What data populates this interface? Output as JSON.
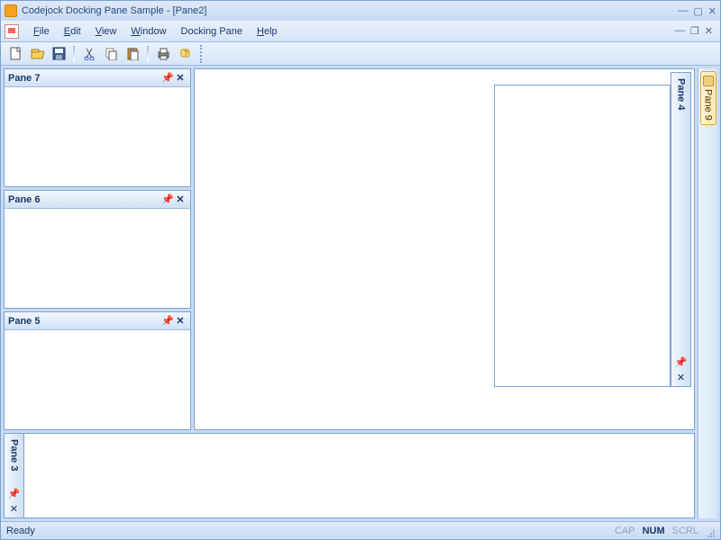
{
  "title": "Codejock Docking Pane Sample - [Pane2]",
  "menus": {
    "file": "File",
    "edit": "Edit",
    "view": "View",
    "window": "Window",
    "docking_pane": "Docking Pane",
    "help": "Help"
  },
  "toolbar_icons": [
    "new",
    "open",
    "save",
    "cut",
    "copy",
    "paste",
    "print",
    "help"
  ],
  "panes": {
    "p7": "Pane 7",
    "p6": "Pane 6",
    "p5": "Pane 5",
    "p4": "Pane 4",
    "p3": "Pane 3",
    "p9": "Pane 9"
  },
  "status": {
    "text": "Ready",
    "cap": "CAP",
    "num": "NUM",
    "scrl": "SCRL"
  }
}
